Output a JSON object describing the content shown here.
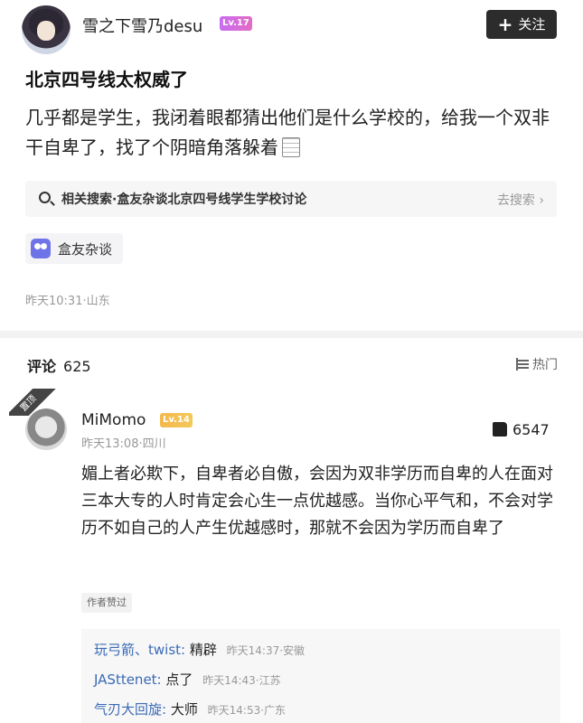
{
  "post": {
    "username": "雪之下雪乃desu",
    "level": "Lv.17",
    "follow_label": "关注",
    "title": "北京四号线太权威了",
    "body": "几乎都是学生，我闭着眼都猜出他们是什么学校的，给我一个双非干自卑了，找了个阴暗角落躲着",
    "related_search": "相关搜索·盒友杂谈北京四号线学生学校讨论",
    "related_go": "去搜索 ›",
    "tag": "盒友杂谈",
    "meta": "昨天10:31·山东"
  },
  "comments": {
    "label": "评论",
    "count": "625",
    "sort_label": "热门",
    "pinned_label": "置顶",
    "top": {
      "username": "MiMomo",
      "level": "Lv.14",
      "meta": "昨天13:08·四川",
      "likes": "6547",
      "body": "媚上者必欺下，自卑者必自傲，会因为双非学历而自卑的人在面对三本大专的人时肯定会心生一点优越感。当你心平气和，不会对学历不如自己的人产生优越感时，那就不会因为学历而自卑了",
      "author_liked": "作者赞过",
      "replies": [
        {
          "name": "玩弓箭、twist:",
          "text": "精辟",
          "meta": "昨天14:37·安徽"
        },
        {
          "name": "JASttenet:",
          "text": "点了",
          "meta": "昨天14:43·江苏"
        },
        {
          "name": "气刃大回旋:",
          "text": "大师",
          "meta": "昨天14:53·广东"
        }
      ]
    }
  }
}
